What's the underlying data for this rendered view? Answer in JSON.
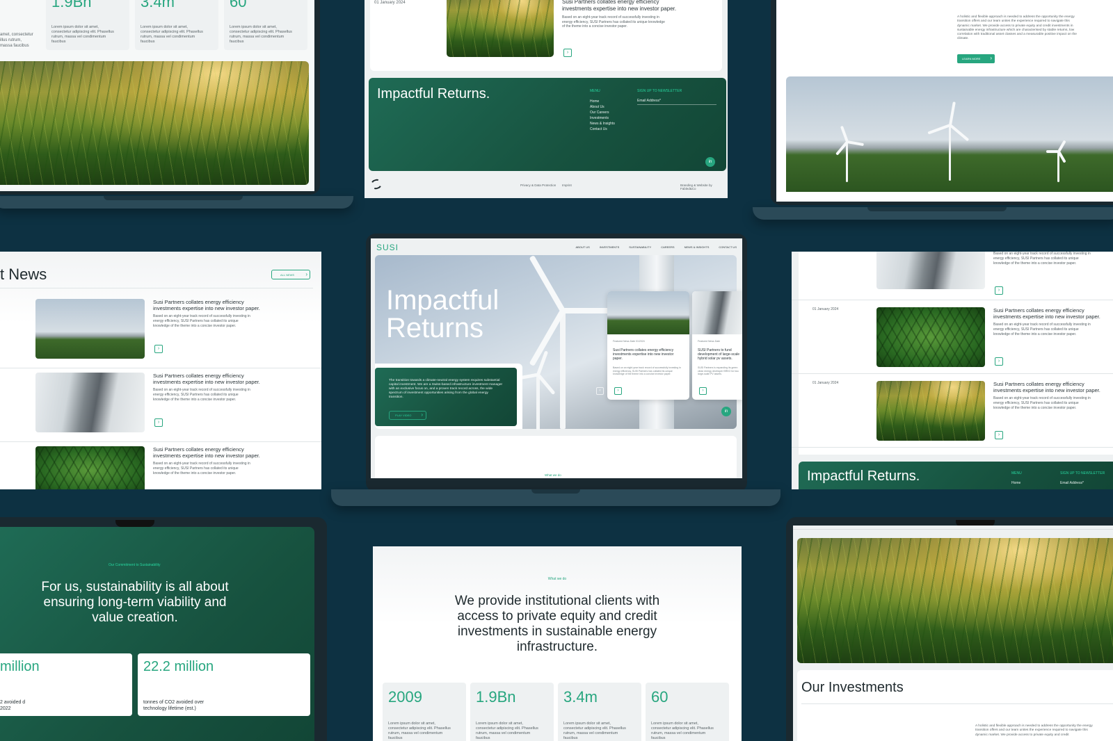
{
  "brand": {
    "logo_text": "SUSI",
    "accent": "#27a67f",
    "background": "#0d3142",
    "dark_green": "#17523f"
  },
  "hero": {
    "nav": [
      "ABOUT US",
      "INVESTMENTS",
      "SUSTAINABILITY",
      "CAREERS",
      "NEWS & INSIGHTS",
      "CONTACT US"
    ],
    "headline_line1": "Impactful",
    "headline_line2": "Returns",
    "intro": "The transition towards a climate-neutral energy system requires substantial capital investment. We are a Swiss-based infrastructure investment manager with an exclusive focus on, and a proven track record across, the wide spectrum of investment opportunities arising from the global energy transition.",
    "cta": "PLAY VIDEO",
    "card1_meta": "Featured News   Date   01/2024",
    "card1_title": "Susi Partners collates energy efficiency investments expertise into new investor paper.",
    "card1_body": "Based on an eight-year track record of successfully investing in energy efficiency, SUSI Partners has collated its unique knowledge of the theme into a concise investor paper.",
    "card2_meta": "Featured News   Date",
    "card2_title": "SUSI Partners to fund development of large-scale hybrid solar pv assets.",
    "card2_body": "SUSI Partners is expanding its green clean energy developer BRKO for two large-scale PV assets.",
    "linkedin": "in",
    "what_we_do": "What we do"
  },
  "footer": {
    "title": "Impactful Returns.",
    "menu_label": "MENU",
    "menu": [
      "Home",
      "About Us",
      "Our Careers",
      "Investments",
      "News & Insights",
      "Contact Us"
    ],
    "newsletter_label": "SIGN UP TO NEWSLETTER",
    "email_placeholder": "Email Address*",
    "privacy": "Privacy & Data Protection",
    "imprint": "Imprint",
    "credit": "Branding & Website by Fabled&Co",
    "date": "01 January 2024",
    "news_title": "Susi Partners collates energy efficiency investments expertise into new investor paper.",
    "news_body": "Based on an eight-year track record of successfully investing in energy efficiency, SUSI Partners has collated its unique knowledge of the theme into a concise investor paper."
  },
  "top_left": {
    "stats": [
      {
        "num": "1.9Bn",
        "desc": "Lorem ipsum dolor sit amet, consectetur adipiscing elit. Phasellus rutrum, massa vel condimentum faucibus"
      },
      {
        "num": "3.4m",
        "desc": "Lorem ipsum dolor sit amet, consectetur adipiscing elit. Phasellus rutrum, massa vel condimentum faucibus"
      },
      {
        "num": "60",
        "desc": "Lorem ipsum dolor sit amet, consectetur adipiscing elit. Phasellus rutrum, massa vel condimentum faucibus"
      }
    ],
    "left_desc": "amet, consectetur illus rutrum, massa faucibus"
  },
  "top_right": {
    "body": "A holistic and flexible approach is needed to address the opportunity the energy transition offers and our team unites the experience required to navigate this dynamic market. We provide access to private equity and credit investments in sustainable energy infrastructure which are characterised by stable returns, low correlation with traditional asset classes and a measurable positive impact on the climate.",
    "cta": "LEARN MORE"
  },
  "news_left": {
    "heading": "t News",
    "all_news": "ALL NEWS",
    "items": [
      {
        "title": "Susi Partners collates energy efficiency investments expertise into new investor paper.",
        "body": "Based on an eight-year track record of successfully investing in energy efficiency, SUSI Partners has collated its unique knowledge of the theme into a concise investor paper."
      },
      {
        "title": "Susi Partners collates energy efficiency investments expertise into new investor paper.",
        "body": "Based on an eight-year track record of successfully investing in energy efficiency, SUSI Partners has collated its unique knowledge of the theme into a concise investor paper."
      },
      {
        "title": "Susi Partners collates energy efficiency investments expertise into new investor paper.",
        "body": "Based on an eight-year track record of successfully investing in energy efficiency, SUSI Partners has collated its unique knowledge of the theme into a concise investor paper."
      }
    ]
  },
  "news_right": {
    "items": [
      {
        "date": "",
        "title": "",
        "body": "Based on an eight-year track record of successfully investing in energy efficiency, SUSI Partners has collated its unique knowledge of the theme into a concise investor paper."
      },
      {
        "date": "01 January 2024",
        "title": "Susi Partners collates energy efficiency investments expertise into new investor paper.",
        "body": "Based on an eight-year track record of successfully investing in energy efficiency, SUSI Partners has collated its unique knowledge of the theme into a concise investor paper."
      },
      {
        "date": "01 January 2024",
        "title": "Susi Partners collates energy efficiency investments expertise into new investor paper.",
        "body": "Based on an eight-year track record of successfully investing in energy efficiency, SUSI Partners has collated its unique knowledge of the theme into a concise investor paper."
      }
    ],
    "footer_title": "Impactful Returns.",
    "menu_label": "MENU",
    "menu_first": "Home",
    "newsletter_label": "SIGN UP TO NEWSLETTER",
    "email_placeholder": "Email Address*"
  },
  "sustainability": {
    "eyebrow": "Our Commitment to Sustainability",
    "headline": "For us, sustainability is all about ensuring long-term viability and value creation.",
    "stat1_num": "million",
    "stat1_desc": "2 avoided d 2022",
    "stat2_num": "22.2 million",
    "stat2_desc": "tonnes of CO2 avoided over technology lifetime (est.)"
  },
  "what_we_do": {
    "eyebrow": "What we do",
    "headline": "We provide institutional clients with access to private equity and credit investments in sustainable energy infrastructure.",
    "stats": [
      {
        "num": "2009",
        "desc": "Lorem ipsum dolor sit amet, consectetur adipiscing elit. Phasellus rutrum, massa vel condimentum faucibus"
      },
      {
        "num": "1.9Bn",
        "desc": "Lorem ipsum dolor sit amet, consectetur adipiscing elit. Phasellus rutrum, massa vel condimentum faucibus"
      },
      {
        "num": "3.4m",
        "desc": "Lorem ipsum dolor sit amet, consectetur adipiscing elit. Phasellus rutrum, massa vel condimentum faucibus"
      },
      {
        "num": "60",
        "desc": "Lorem ipsum dolor sit amet, consectetur adipiscing elit. Phasellus rutrum, massa vel condimentum faucibus"
      }
    ]
  },
  "investments": {
    "heading": "Our Investments",
    "body": "A holistic and flexible approach is needed to address the opportunity the energy transition offers and our team unites the experience required to navigate this dynamic market. We provide access to private equity and credit"
  }
}
